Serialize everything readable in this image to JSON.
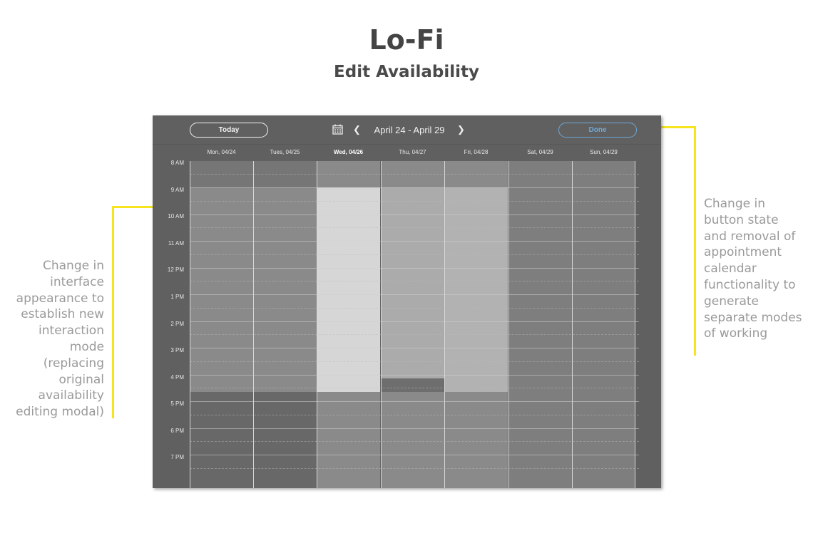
{
  "page": {
    "title": "Lo-Fi",
    "subtitle": "Edit Availability"
  },
  "notes": {
    "left": "Change in interface appearance to establish new interaction mode (replacing original availability editing modal)",
    "right": "Change in button state and removal of appointment calendar functionality to generate separate modes of working"
  },
  "toolbar": {
    "today_label": "Today",
    "range_label": "April 24 - April 29",
    "done_label": "Done",
    "calendar_icon": "calendar-icon",
    "prev_icon": "chevron-left-icon",
    "next_icon": "chevron-right-icon"
  },
  "days": [
    {
      "label": "Mon, 04/24",
      "is_today": false
    },
    {
      "label": "Tues, 04/25",
      "is_today": false
    },
    {
      "label": "Wed, 04/26",
      "is_today": true
    },
    {
      "label": "Thu, 04/27",
      "is_today": false
    },
    {
      "label": "Fri, 04/28",
      "is_today": false
    },
    {
      "label": "Sat, 04/29",
      "is_today": false
    },
    {
      "label": "Sun, 04/29",
      "is_today": false
    }
  ],
  "times": [
    "8 AM",
    "9 AM",
    "10 AM",
    "11 AM",
    "12 PM",
    "1 PM",
    "2 PM",
    "3 PM",
    "4 PM",
    "5 PM",
    "6 PM",
    "7 PM"
  ],
  "colors": {
    "accent": "#f6e51e",
    "done_button": "#6fa8d8",
    "app_background": "#606060",
    "selected_day": "#d6d6d6",
    "available": "#8a8a8a",
    "unavailable": "#6a6a6a"
  }
}
